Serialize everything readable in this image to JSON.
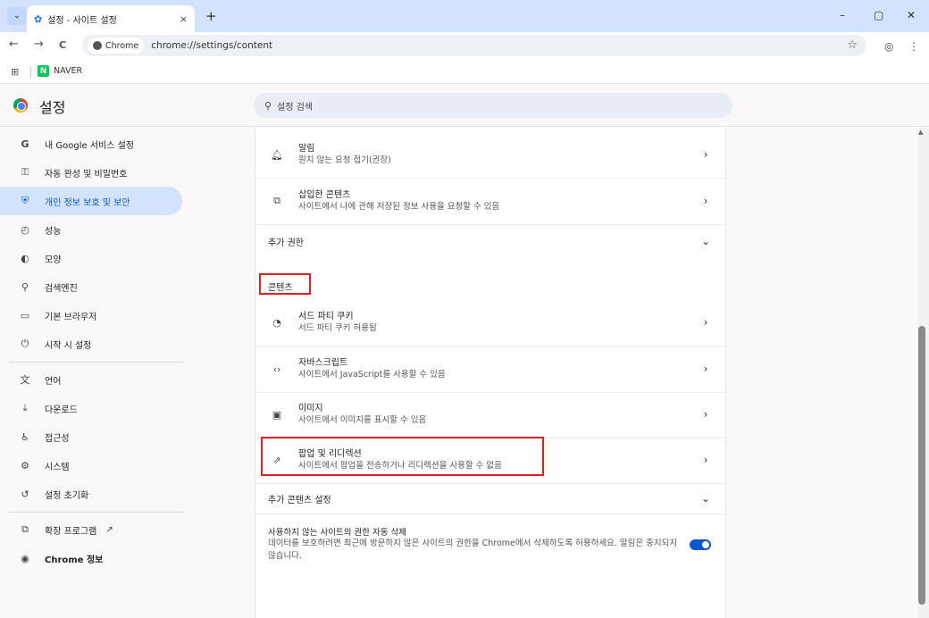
{
  "tab": {
    "title": "설정 - 사이트 설정",
    "close": "×",
    "new": "+"
  },
  "window": {
    "minimize": "–",
    "maximize": "▢",
    "close": "✕"
  },
  "toolbar": {
    "back": "←",
    "forward": "→",
    "reload": "C",
    "chip": "Chrome",
    "url": "chrome://settings/content",
    "star": "☆",
    "profile": "◎",
    "menu": "⋮"
  },
  "bookmarks": {
    "apps": "⊞",
    "naver_logo": "N",
    "naver": "NAVER"
  },
  "header": {
    "title": "설정",
    "search_placeholder": "설정 검색",
    "search_icon": "search-icon"
  },
  "sidebar": {
    "items": [
      {
        "icon": "G",
        "label": "내 Google 서비스 설정"
      },
      {
        "icon": "⚿",
        "label": "자동 완성 및 비밀번호"
      },
      {
        "icon": "⛨",
        "label": "개인 정보 보호 및 보안"
      },
      {
        "icon": "◴",
        "label": "성능"
      },
      {
        "icon": "◐",
        "label": "모양"
      },
      {
        "icon": "⚲",
        "label": "검색엔진"
      },
      {
        "icon": "▭",
        "label": "기본 브라우저"
      },
      {
        "icon": "⏻",
        "label": "시작 시 설정"
      },
      {
        "icon": "文",
        "label": "언어"
      },
      {
        "icon": "⤓",
        "label": "다운로드"
      },
      {
        "icon": "♿",
        "label": "접근성"
      },
      {
        "icon": "⚙",
        "label": "시스템"
      },
      {
        "icon": "↺",
        "label": "설정 초기화"
      },
      {
        "icon": "⧉",
        "label": "확장 프로그램"
      },
      {
        "icon": "◉",
        "label": "Chrome 정보"
      }
    ],
    "ext_link_icon": "↗"
  },
  "content": {
    "notifications": {
      "title": "알림",
      "sub": "원치 않는 요청 접기(권장)"
    },
    "embedded": {
      "title": "삽입한 콘텐츠",
      "sub": "사이트에서 나에 관해 저장된 정보 사용을 요청할 수 있음"
    },
    "additional_permissions": "추가 권한",
    "content_section": "콘텐츠",
    "cookies": {
      "title": "서드 파티 쿠키",
      "sub": "서드 파티 쿠키 허용됨"
    },
    "javascript": {
      "title": "자바스크립트",
      "sub": "사이트에서 JavaScript를 사용할 수 있음"
    },
    "images": {
      "title": "이미지",
      "sub": "사이트에서 이미지를 표시할 수 있음"
    },
    "popups": {
      "title": "팝업 및 리디렉션",
      "sub": "사이트에서 팝업을 전송하거나 리디렉션을 사용할 수 없음"
    },
    "additional_content": "추가 콘텐츠 설정",
    "auto_delete": {
      "title": "사용하지 않는 사이트의 권한 자동 삭제",
      "desc": "데이터를 보호하려면 최근에 방문하지 않은 사이트의 권한을 Chrome에서 삭제하도록 허용하세요. 알림은 중지되지 않습니다.",
      "enabled": true
    },
    "chevron_right": "›",
    "chevron_down": "⌄"
  },
  "colors": {
    "accent": "#0b57d0",
    "active_bg": "#d3e3fd",
    "highlight_box": "#e0201f"
  }
}
